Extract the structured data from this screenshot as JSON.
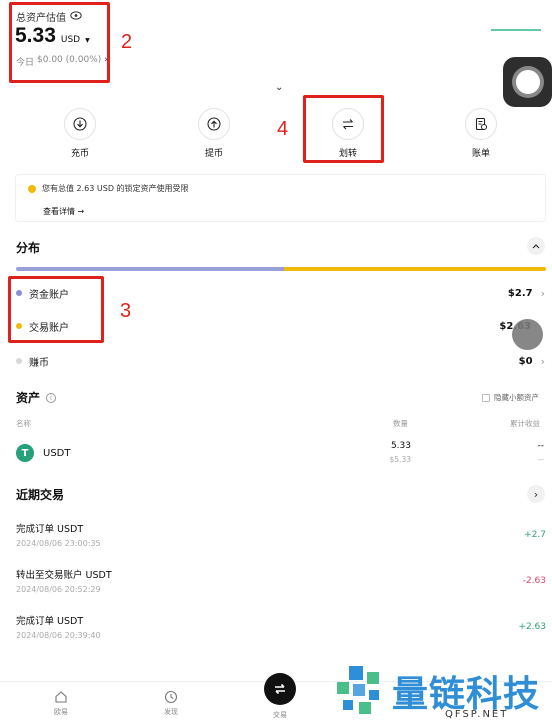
{
  "header": {
    "total_label": "总资产估值",
    "total_value": "5.33",
    "currency": "USD",
    "today_label": "今日",
    "today_value": "$0.00 (0.00%)"
  },
  "actions": [
    {
      "label": "充币",
      "icon": "download-icon"
    },
    {
      "label": "提币",
      "icon": "upload-icon"
    },
    {
      "label": "划转",
      "icon": "transfer-icon"
    },
    {
      "label": "账单",
      "icon": "bill-icon"
    }
  ],
  "notice": {
    "text": "您有总值 2.63 USD 的锁定资产使用受限",
    "link": "查看详情 →"
  },
  "distribution": {
    "title": "分布",
    "items": [
      {
        "label": "资金账户",
        "value": "$2.7",
        "color": "#8b8fd6"
      },
      {
        "label": "交易账户",
        "value": "$2.63",
        "color": "#f0b90b"
      },
      {
        "label": "赚币",
        "value": "$0",
        "color": "#d8d8d8"
      }
    ],
    "bar_fraction_primary": 0.506
  },
  "assets": {
    "title": "资产",
    "hide_small_label": "隐藏小额资产",
    "col_name": "名称",
    "col_qty": "数量",
    "col_pnl": "累计收益",
    "rows": [
      {
        "name": "USDT",
        "qty": "5.33",
        "qty_usd": "$5.33",
        "pnl": "--",
        "pnl2": "--"
      }
    ]
  },
  "recent": {
    "title": "近期交易",
    "items": [
      {
        "title": "完成订单 USDT",
        "date": "2024/08/06 23:00:35",
        "amount": "+2.7",
        "color": "#2ea370"
      },
      {
        "title": "转出至交易账户 USDT",
        "date": "2024/08/06 20:52:29",
        "amount": "-2.63",
        "color": "#d8486a"
      },
      {
        "title": "完成订单 USDT",
        "date": "2024/08/06 20:39:40",
        "amount": "+2.63",
        "color": "#2ea370"
      }
    ]
  },
  "nav": [
    {
      "label": "欧易"
    },
    {
      "label": "发现"
    },
    {
      "label": "交易"
    }
  ],
  "annotations": [
    "2",
    "3",
    "4"
  ],
  "watermark": {
    "brand": "量链科技",
    "domain": "QFSP.NET"
  }
}
